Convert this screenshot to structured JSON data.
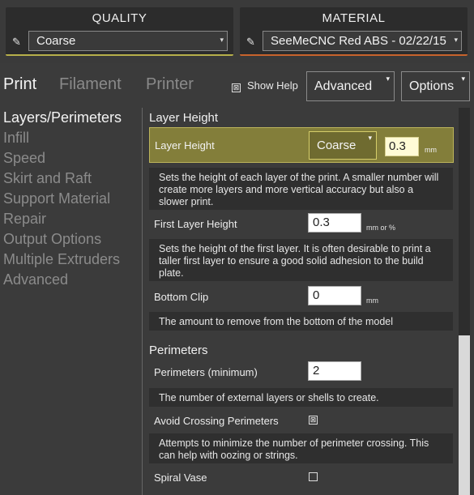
{
  "quality": {
    "title": "QUALITY",
    "value": "Coarse",
    "accent": "#b7b04a"
  },
  "material": {
    "title": "MATERIAL",
    "value": "SeeMeCNC Red ABS - 02/22/15",
    "accent": "#c8632c"
  },
  "tabs": {
    "print": "Print",
    "filament": "Filament",
    "printer": "Printer"
  },
  "show_help": {
    "label": "Show Help",
    "checked": true,
    "mark": "⊠"
  },
  "mode_select": {
    "value": "Advanced"
  },
  "options_button": {
    "label": "Options"
  },
  "caret": "▾",
  "pencil": "✎",
  "sidebar": {
    "items": [
      {
        "label": "Layers/Perimeters",
        "active": true
      },
      {
        "label": "Infill",
        "active": false
      },
      {
        "label": "Speed",
        "active": false
      },
      {
        "label": "Skirt and Raft",
        "active": false
      },
      {
        "label": "Support Material",
        "active": false
      },
      {
        "label": "Repair",
        "active": false
      },
      {
        "label": "Output Options",
        "active": false
      },
      {
        "label": "Multiple Extruders",
        "active": false
      },
      {
        "label": "Advanced",
        "active": false
      }
    ]
  },
  "layer_height_section": {
    "title": "Layer Height",
    "layer_height": {
      "label": "Layer Height",
      "preset": "Coarse",
      "value": "0.3",
      "unit": "mm",
      "help": "Sets the height of each layer of the print. A smaller number will create more layers and more vertical accuracy but also a slower print."
    },
    "first_layer_height": {
      "label": "First Layer Height",
      "value": "0.3",
      "unit": "mm or %",
      "help": "Sets the height of the first layer. It is often desirable to print a taller first layer to ensure a good solid adhesion to the build plate."
    },
    "bottom_clip": {
      "label": "Bottom Clip",
      "value": "0",
      "unit": "mm",
      "help": "The amount to remove from the bottom of the model"
    }
  },
  "perimeters_section": {
    "title": "Perimeters",
    "perimeters_min": {
      "label": "Perimeters (minimum)",
      "value": "2",
      "help": "The number of external layers or shells to create."
    },
    "avoid_crossing": {
      "label": "Avoid Crossing Perimeters",
      "checked": true,
      "mark": "⊠",
      "help": "Attempts to minimize the number of perimeter crossing. This can help with oozing or strings."
    },
    "spiral_vase": {
      "label": "Spiral Vase",
      "checked": false,
      "mark": ""
    }
  },
  "colors": {
    "background": "#3b3b3b",
    "highlight": "#837e3a",
    "help_bg": "#2f2f2f"
  }
}
